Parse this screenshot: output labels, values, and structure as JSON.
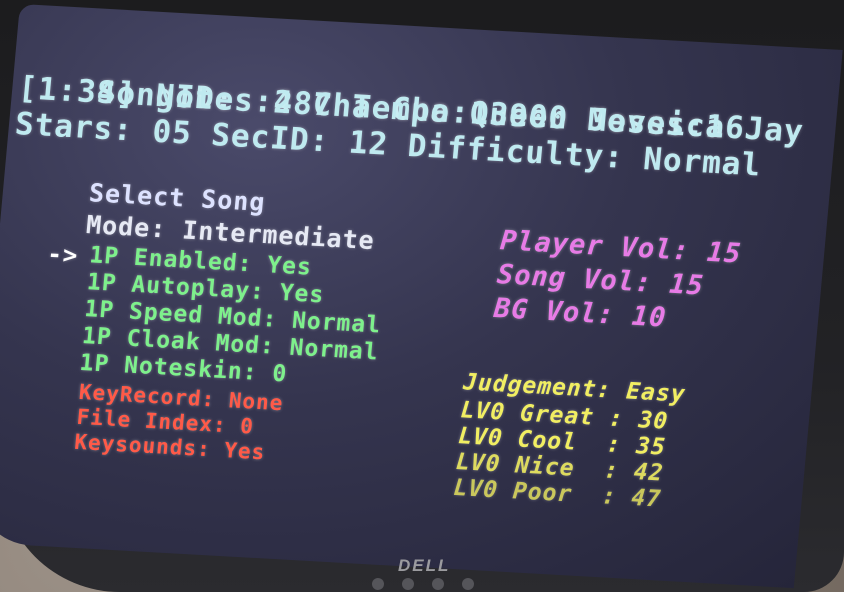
{
  "song": {
    "line1_label": "SongID:",
    "song_title": "4 Cha Cha Queen Jessica Jay",
    "line2": "[1:34] Notes:287 Tempo:13900 Moves:16",
    "line3": "Stars: 05 SecID: 12 Difficulty: Normal"
  },
  "menu": {
    "title": "Select Song",
    "mode": "Mode: Intermediate",
    "cursor": "->",
    "green_items": [
      "1P Enabled: Yes",
      "1P Autoplay: Yes",
      "1P Speed Mod: Normal",
      "1P Cloak Mod: Normal",
      "1P Noteskin: 0"
    ],
    "red_items": [
      "KeyRecord: None",
      "File Index: 0",
      "Keysounds: Yes"
    ]
  },
  "volume": {
    "player": "Player Vol: 15",
    "song": "Song Vol: 15",
    "bg": "BG Vol: 10"
  },
  "judgement": {
    "title": "Judgement: Easy",
    "rows": [
      "LV0 Great : 30",
      "LV0 Cool  : 35",
      "LV0 Nice  : 42",
      "LV0 Poor  : 47"
    ]
  },
  "monitor": {
    "brand": "DELL"
  },
  "colors": {
    "header": "#bfeaf0",
    "enabled_options": "#7ef08c",
    "debug_options": "#ff5a48",
    "volume": "#e77be6",
    "judgement": "#f1ee62"
  }
}
